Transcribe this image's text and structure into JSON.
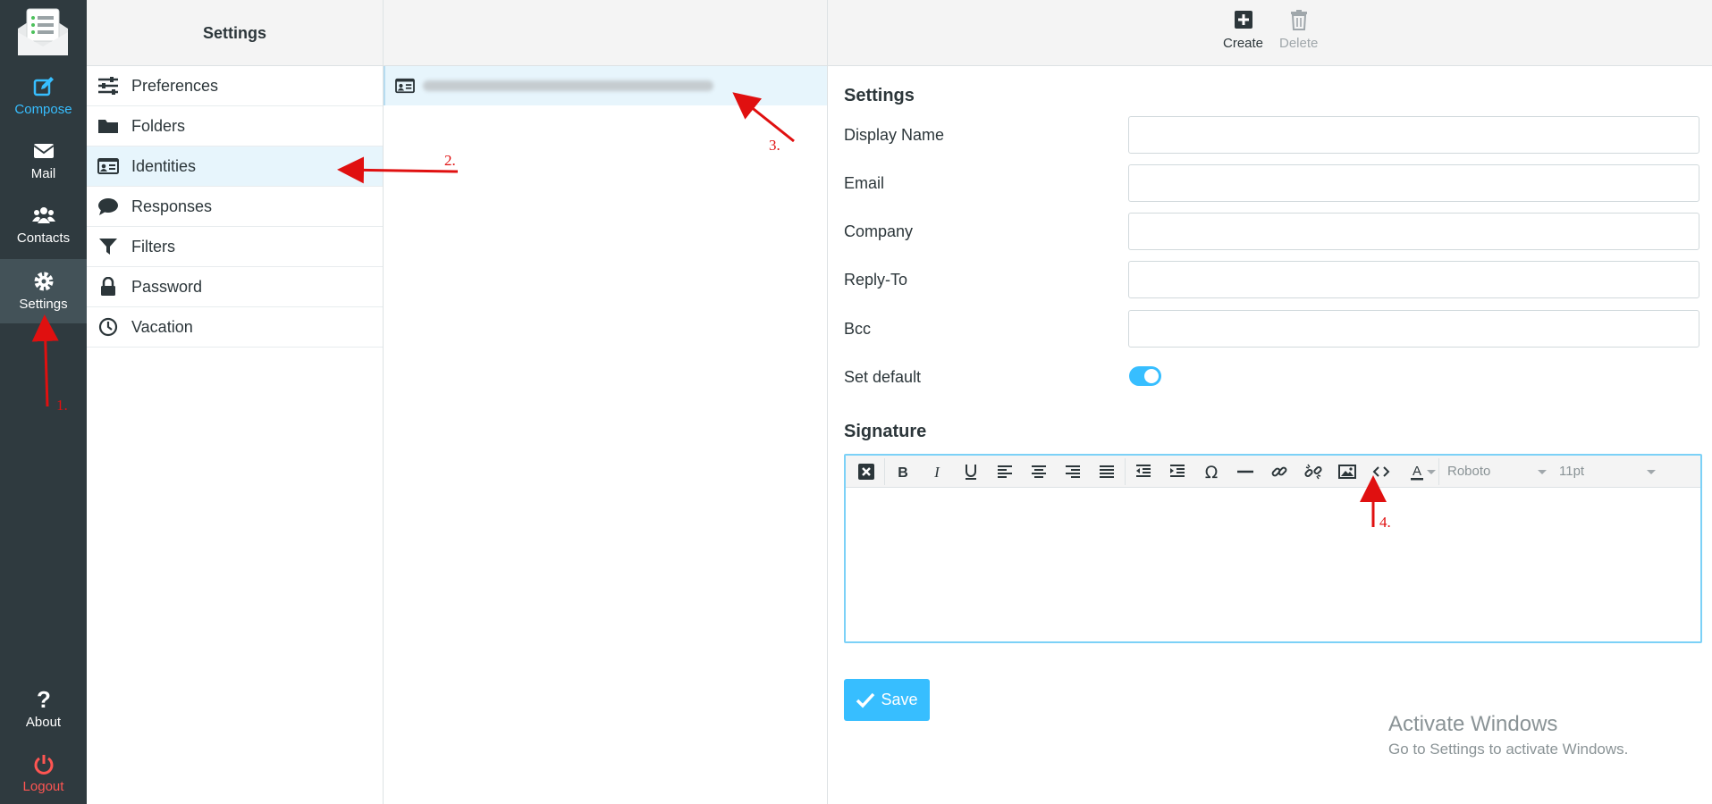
{
  "nav": {
    "items": [
      {
        "label": "Compose",
        "icon": "compose-icon"
      },
      {
        "label": "Mail",
        "icon": "mail-icon"
      },
      {
        "label": "Contacts",
        "icon": "contacts-icon"
      },
      {
        "label": "Settings",
        "icon": "gear-icon"
      }
    ],
    "about": "About",
    "logout": "Logout"
  },
  "settings_panel": {
    "title": "Settings",
    "items": [
      {
        "label": "Preferences",
        "icon": "sliders-icon"
      },
      {
        "label": "Folders",
        "icon": "folder-icon"
      },
      {
        "label": "Identities",
        "icon": "id-card-icon"
      },
      {
        "label": "Responses",
        "icon": "comment-icon"
      },
      {
        "label": "Filters",
        "icon": "filter-icon"
      },
      {
        "label": "Password",
        "icon": "lock-icon"
      },
      {
        "label": "Vacation",
        "icon": "clock-icon"
      }
    ],
    "selected": "Identities"
  },
  "toolbar": {
    "create": "Create",
    "delete": "Delete"
  },
  "form": {
    "section_title": "Settings",
    "fields": [
      {
        "label": "Display Name",
        "value": ""
      },
      {
        "label": "Email",
        "value": ""
      },
      {
        "label": "Company",
        "value": ""
      },
      {
        "label": "Reply-To",
        "value": ""
      },
      {
        "label": "Bcc",
        "value": ""
      }
    ],
    "set_default_label": "Set default",
    "set_default_on": true,
    "signature_title": "Signature",
    "font_family": "Roboto",
    "font_size": "11pt",
    "save": "Save"
  },
  "watermark": {
    "title": "Activate Windows",
    "subtitle": "Go to Settings to activate Windows."
  },
  "annotations": [
    "1.",
    "2.",
    "3.",
    "4."
  ],
  "colors": {
    "accent": "#37beff",
    "nav_bg": "#2f3a3f",
    "logout": "#ff5552",
    "annotation": "#e01010"
  }
}
